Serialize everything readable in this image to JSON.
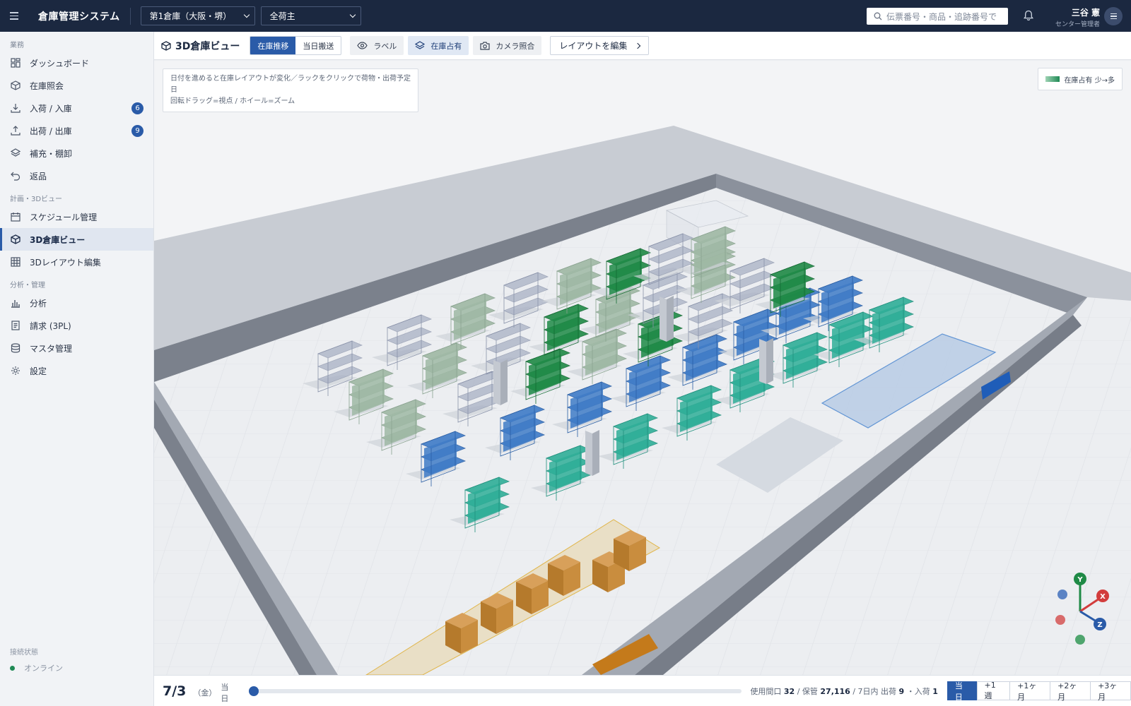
{
  "topbar": {
    "app_title": "倉庫管理システム",
    "warehouse": "第1倉庫（大阪・堺）",
    "shipper": "全荷主",
    "search_placeholder": "伝票番号・商品・追跡番号で",
    "user_name": "三谷 憲",
    "user_role": "センター管理者"
  },
  "sidebar": {
    "sections": [
      "業務",
      "計画・3Dビュー",
      "分析・管理"
    ],
    "items": [
      {
        "label": "ダッシュボード",
        "icon": "dashboard-icon"
      },
      {
        "label": "在庫照会",
        "icon": "box-icon"
      },
      {
        "label": "入荷 / 入庫",
        "icon": "download-icon",
        "badge": "6"
      },
      {
        "label": "出荷 / 出庫",
        "icon": "upload-icon",
        "badge": "9"
      },
      {
        "label": "補充・棚卸",
        "icon": "layers-icon"
      },
      {
        "label": "返品",
        "icon": "undo-icon"
      },
      {
        "label": "スケジュール管理",
        "icon": "calendar-icon"
      },
      {
        "label": "3D倉庫ビュー",
        "icon": "cube-icon",
        "active": true
      },
      {
        "label": "3Dレイアウト編集",
        "icon": "grid-icon"
      },
      {
        "label": "分析",
        "icon": "bar-chart-icon"
      },
      {
        "label": "請求 (3PL)",
        "icon": "document-icon"
      },
      {
        "label": "マスタ管理",
        "icon": "database-icon"
      },
      {
        "label": "設定",
        "icon": "gear-icon"
      }
    ],
    "connection_label": "接続状態",
    "connection_status": "オンライン"
  },
  "toolbar": {
    "title": "3D倉庫ビュー",
    "mode_tabs": [
      "在庫推移",
      "当日搬送"
    ],
    "active_mode": "在庫推移",
    "toggles": [
      {
        "label": "ラベル",
        "icon": "eye-icon",
        "on": false
      },
      {
        "label": "在庫占有",
        "icon": "layers-icon",
        "on": true
      },
      {
        "label": "カメラ照合",
        "icon": "camera-icon",
        "on": false
      }
    ],
    "edit_layout": "レイアウトを編集"
  },
  "viewport": {
    "hint_line1": "日付を進めると在庫レイアウトが変化／ラックをクリックで荷物・出荷予定日",
    "hint_line2": "回転ドラッグ=視点 / ホイール=ズーム",
    "legend": "在庫占有 少→多",
    "axis_labels": [
      "Y",
      "X",
      "Z"
    ],
    "colors": {
      "rack_empty": "#a9b1c4",
      "rack_low": "#9fb8a4",
      "rack_high": "#1f8a46",
      "rack_shipping": "#3f7bc7",
      "rack_teal": "#2fae98",
      "box": "#c98d3e"
    }
  },
  "bottombar": {
    "date": "7/3",
    "weekday": "（金）",
    "today": "当日",
    "timeline_position": 0,
    "stats_prefix1": "使用間口",
    "used_slots": "32",
    "stats_prefix2": " / 保管",
    "stored": "27,116",
    "stats_prefix3": " / 7日内 出荷",
    "shipments": "9",
    "stats_prefix4": "・入荷",
    "arrivals": "1",
    "ranges": [
      "当日",
      "+1週",
      "+1ヶ月",
      "+2ヶ月",
      "+3ヶ月"
    ],
    "active_range": "当日"
  }
}
